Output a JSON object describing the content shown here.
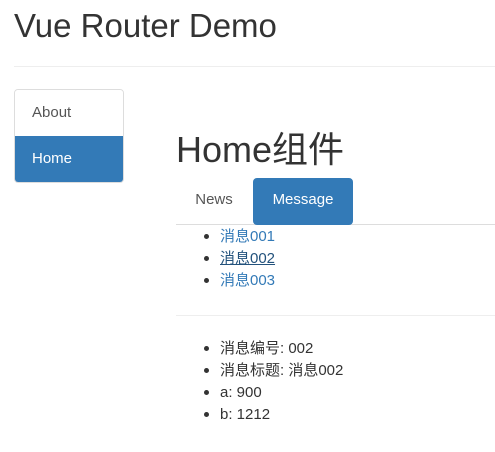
{
  "header": {
    "title": "Vue Router Demo"
  },
  "sidebar": {
    "items": [
      {
        "label": "About",
        "active": false
      },
      {
        "label": "Home",
        "active": true
      }
    ]
  },
  "main": {
    "title": "Home组件",
    "tabs": [
      {
        "label": "News",
        "active": false
      },
      {
        "label": "Message",
        "active": true
      }
    ],
    "messages": [
      {
        "label": "消息001"
      },
      {
        "label": "消息002 "
      },
      {
        "label": "消息003"
      }
    ],
    "detail": {
      "id_label": "消息编号: 002",
      "title_label": "消息标题: 消息002",
      "a_label": "a: 900",
      "b_label": "b: 1212"
    }
  },
  "colors": {
    "primary": "#337ab7",
    "text": "#333333",
    "muted": "#555555",
    "border": "#dddddd"
  }
}
